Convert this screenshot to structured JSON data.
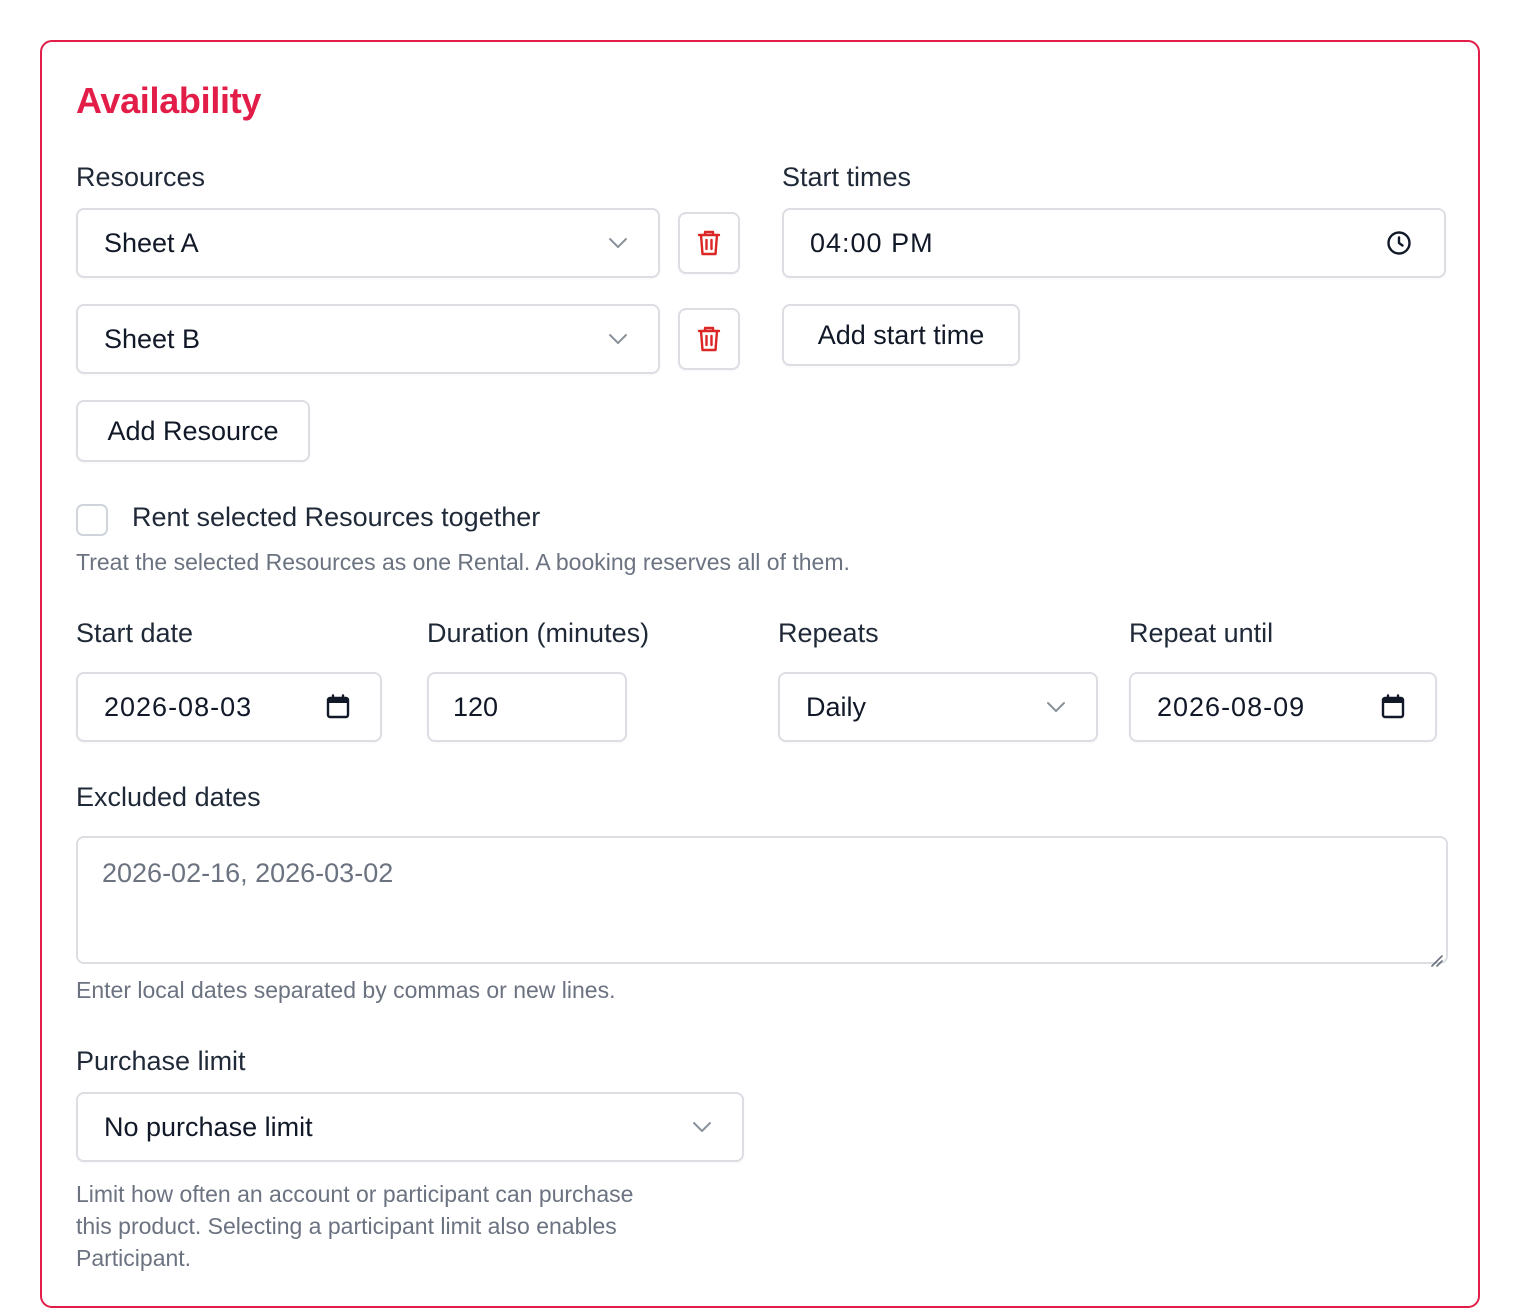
{
  "section": {
    "title": "Availability"
  },
  "resources": {
    "label": "Resources",
    "items": [
      {
        "value": "Sheet A"
      },
      {
        "value": "Sheet B"
      }
    ],
    "add_label": "Add Resource"
  },
  "start_times": {
    "label": "Start times",
    "items": [
      {
        "value": "04:00 PM"
      }
    ],
    "add_label": "Add start time"
  },
  "rent_together": {
    "label": "Rent selected Resources together",
    "checked": false,
    "help": "Treat the selected Resources as one Rental. A booking reserves all of them."
  },
  "start_date": {
    "label": "Start date",
    "value": "2026-08-03"
  },
  "duration": {
    "label": "Duration (minutes)",
    "value": "120"
  },
  "repeats": {
    "label": "Repeats",
    "value": "Daily"
  },
  "repeat_until": {
    "label": "Repeat until",
    "value": "2026-08-09"
  },
  "excluded_dates": {
    "label": "Excluded dates",
    "placeholder": "2026-02-16, 2026-03-02",
    "help": "Enter local dates separated by commas or new lines."
  },
  "purchase_limit": {
    "label": "Purchase limit",
    "value": "No purchase limit",
    "help_lines": [
      "Limit how often an account or participant can purchase",
      "this product. Selecting a participant limit also enables",
      "Participant."
    ]
  },
  "colors": {
    "accent": "#e11d48",
    "danger_icon": "#dc2626",
    "border": "#dcdee3",
    "muted_text": "#6b7280"
  }
}
